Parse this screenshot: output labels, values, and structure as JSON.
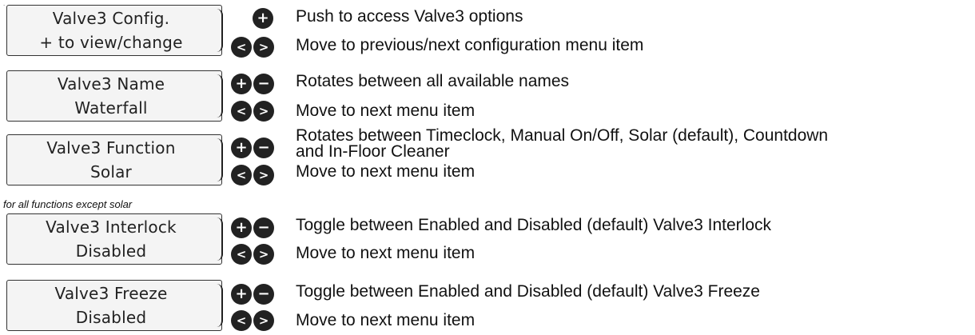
{
  "rows": [
    {
      "screen": {
        "line1": "Valve3 Config.",
        "line2": "+ to view/change"
      },
      "text1": "Push to access Valve3 options",
      "text2": "Move to previous/next configuration menu item"
    },
    {
      "screen": {
        "line1": "Valve3 Name",
        "line2": "Waterfall"
      },
      "text1": "Rotates between all available names",
      "text2": "Move to next menu item"
    },
    {
      "screen": {
        "line1": "Valve3 Function",
        "line2": "Solar"
      },
      "text1a": "Rotates between Timeclock, Manual On/Off, Solar (default), Countdown",
      "text1b": "and In-Floor Cleaner",
      "text2": "Move to next menu item"
    },
    {
      "note": "for all functions except solar",
      "screen": {
        "line1": "Valve3 Interlock",
        "line2": "Disabled"
      },
      "text1": "Toggle between Enabled and Disabled (default) Valve3 Interlock",
      "text2": "Move to next menu item"
    },
    {
      "screen": {
        "line1": "Valve3 Freeze",
        "line2": "Disabled"
      },
      "text1": "Toggle between Enabled and Disabled (default) Valve3 Freeze",
      "text2": "Move to next menu item"
    }
  ],
  "buttons": {
    "plus": "+",
    "minus": "−",
    "left": "<",
    "right": ">"
  },
  "icons": {
    "plus": "plus-button-icon",
    "minus": "minus-button-icon",
    "left": "left-arrow-button-icon",
    "right": "right-arrow-button-icon"
  }
}
